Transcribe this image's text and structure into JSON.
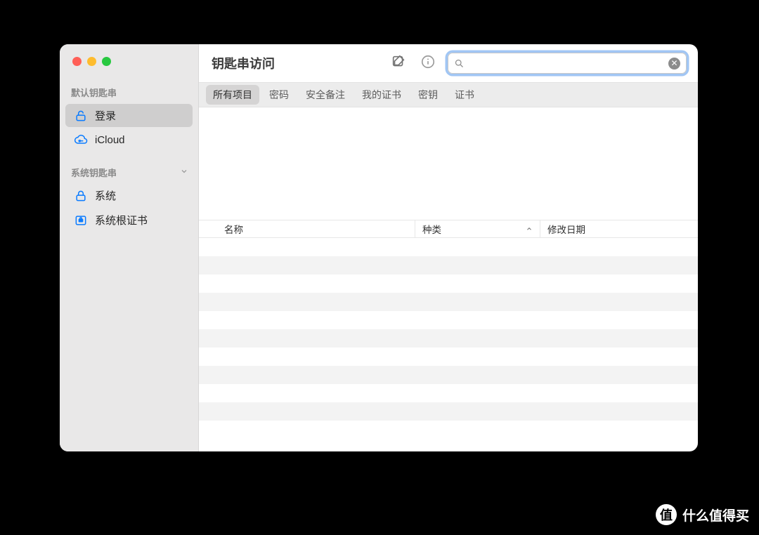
{
  "window": {
    "title": "钥匙串访问"
  },
  "search": {
    "value": "",
    "placeholder": ""
  },
  "sidebar": {
    "sections": [
      {
        "header": "默认钥匙串",
        "collapsible": false,
        "items": [
          {
            "icon": "unlock",
            "label": "登录",
            "selected": true
          },
          {
            "icon": "cloud-key",
            "label": "iCloud",
            "selected": false
          }
        ]
      },
      {
        "header": "系统钥匙串",
        "collapsible": true,
        "items": [
          {
            "icon": "lock",
            "label": "系统",
            "selected": false
          },
          {
            "icon": "cert",
            "label": "系统根证书",
            "selected": false
          }
        ]
      }
    ]
  },
  "tabs": [
    {
      "label": "所有项目",
      "selected": true
    },
    {
      "label": "密码",
      "selected": false
    },
    {
      "label": "安全备注",
      "selected": false
    },
    {
      "label": "我的证书",
      "selected": false
    },
    {
      "label": "密钥",
      "selected": false
    },
    {
      "label": "证书",
      "selected": false
    }
  ],
  "columns": {
    "name": "名称",
    "kind": "种类",
    "date": "修改日期",
    "sort_column": "kind",
    "sort_dir": "asc"
  },
  "rows": [],
  "watermark": {
    "badge": "值",
    "text": "什么值得买"
  }
}
